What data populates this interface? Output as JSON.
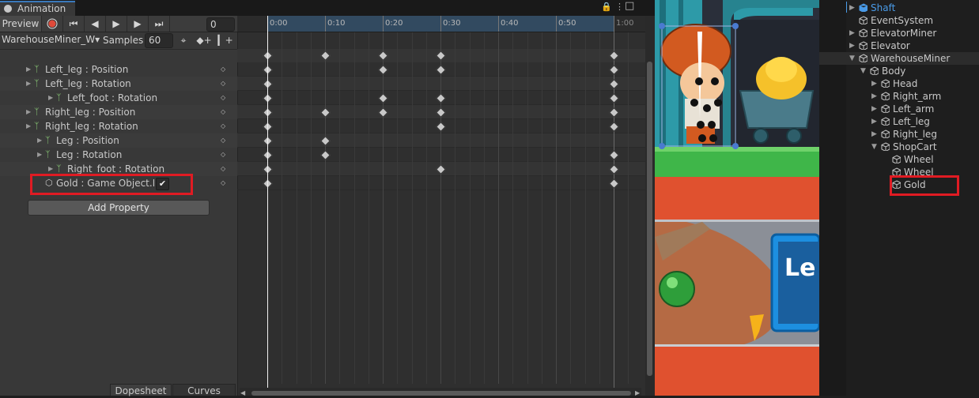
{
  "animation": {
    "tab_title": "Animation",
    "preview_label": "Preview",
    "frame_value": "0",
    "clip_name": "WarehouseMiner_W▾",
    "samples_label": "Samples",
    "samples_value": "60",
    "add_property_label": "Add Property",
    "bottom_tabs": [
      "Dopesheet",
      "Curves"
    ],
    "properties": [
      {
        "name": "Left_leg : Position"
      },
      {
        "name": "Left_leg : Rotation"
      },
      {
        "name": "Left_foot : Rotation"
      },
      {
        "name": "Right_leg : Position"
      },
      {
        "name": "Right_leg : Rotation"
      },
      {
        "name": "Leg : Position"
      },
      {
        "name": "Leg : Rotation"
      },
      {
        "name": "Right_foot : Rotation"
      },
      {
        "name": "Gold : Game Object.Is A",
        "toggle": "✔"
      }
    ],
    "time_ticks": [
      "0:00",
      "0:10",
      "0:20",
      "0:30",
      "0:40",
      "0:50",
      "1:00"
    ],
    "keyframe_times": {
      "summary": [
        0,
        10,
        20,
        30,
        60
      ],
      "rows": [
        [
          0,
          20,
          30,
          60
        ],
        [
          0,
          60
        ],
        [
          0,
          20,
          30,
          60
        ],
        [
          0,
          10,
          20,
          30,
          60
        ],
        [
          0,
          30,
          60
        ],
        [
          0,
          10
        ],
        [
          0,
          10,
          60
        ],
        [
          0,
          30,
          60
        ],
        [
          0,
          60
        ]
      ]
    }
  },
  "hierarchy": {
    "items": [
      {
        "label": "Shaft",
        "highlight": true
      },
      {
        "label": "EventSystem"
      },
      {
        "label": "ElevatorMiner"
      },
      {
        "label": "Elevator"
      },
      {
        "label": "WarehouseMiner"
      },
      {
        "label": "Body"
      },
      {
        "label": "Head"
      },
      {
        "label": "Right_arm"
      },
      {
        "label": "Left_arm"
      },
      {
        "label": "Left_leg"
      },
      {
        "label": "Right_leg"
      },
      {
        "label": "ShopCart"
      },
      {
        "label": "Wheel"
      },
      {
        "label": "Wheel"
      },
      {
        "label": "Gold"
      }
    ]
  },
  "scene": {
    "sign_text": "Le"
  },
  "colors": {
    "accent_blue": "#3a79bb",
    "highlight_red": "#e01b23",
    "ruler_blue": "#324a60",
    "shaft_blue": "#4a9be8"
  }
}
